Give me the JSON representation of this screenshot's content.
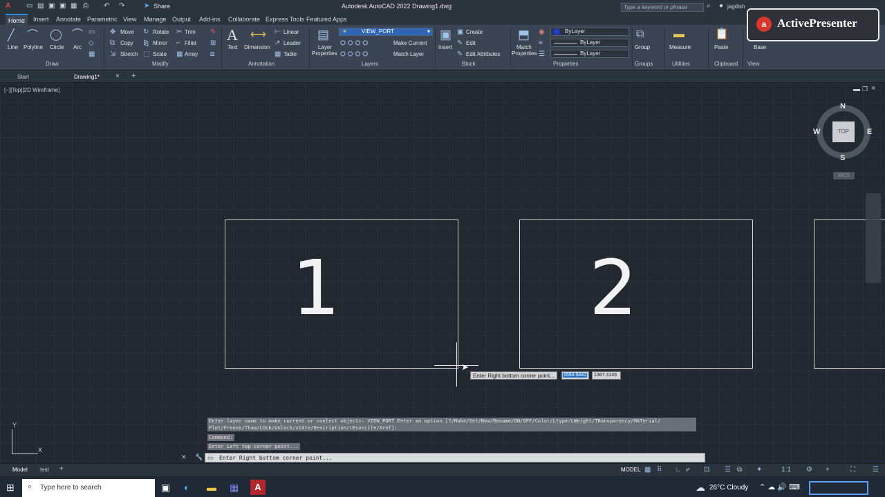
{
  "app": {
    "title": "Autodesk AutoCAD 2022    Drawing1.dwg",
    "share_label": "Share",
    "search_placeholder": "Type a keyword or phrase",
    "user": "jagdish"
  },
  "ribbon_tabs": [
    "Home",
    "Insert",
    "Annotate",
    "Parametric",
    "View",
    "Manage",
    "Output",
    "Add-ins",
    "Collaborate",
    "Express Tools",
    "Featured Apps"
  ],
  "draw": {
    "line": "Line",
    "polyline": "Polyline",
    "circle": "Circle",
    "arc": "Arc",
    "title": "Draw"
  },
  "modify": {
    "move": "Move",
    "rotate": "Rotate",
    "trim": "Trim",
    "copy": "Copy",
    "mirror": "Mirror",
    "fillet": "Fillet",
    "stretch": "Stretch",
    "scale": "Scale",
    "array": "Array",
    "title": "Modify"
  },
  "annotation": {
    "text": "Text",
    "dimension": "Dimension",
    "linear": "Linear",
    "leader": "Leader",
    "table": "Table",
    "title": "Annotation"
  },
  "layers": {
    "layer_properties_1": "Layer",
    "layer_properties_2": "Properties",
    "current_layer": "VIEW_PORT",
    "make_current": "Make Current",
    "match_layer": "Match Layer",
    "title": "Layers"
  },
  "block": {
    "insert": "Insert",
    "create": "Create",
    "edit": "Edit",
    "edit_attributes": "Edit Attributes",
    "title": "Block"
  },
  "properties": {
    "match_1": "Match",
    "match_2": "Properties",
    "color": "ByLayer",
    "linetype": "ByLayer",
    "lineweight": "ByLayer",
    "title": "Properties"
  },
  "groups": {
    "group": "Group",
    "title": "Groups"
  },
  "utilities": {
    "measure": "Measure",
    "title": "Utilities"
  },
  "clipboard": {
    "paste": "Paste",
    "title": "Clipboard"
  },
  "view_panel": {
    "base": "Base",
    "title": "View"
  },
  "doc_tabs": {
    "start": "Start",
    "drawing": "Drawing1*"
  },
  "viewport_label": "[−][Top][2D Wireframe]",
  "viewports": [
    {
      "label": "1"
    },
    {
      "label": "2"
    }
  ],
  "viewcube": {
    "north": "N",
    "south": "S",
    "east": "E",
    "west": "W",
    "top": "TOP",
    "wcs": "WCS"
  },
  "dynamic_input": {
    "prompt": "Enter Right bottom corner point...",
    "x": "1694.9442",
    "y": "1387.3146"
  },
  "command_history": [
    "Enter layer name to make current or <select object>: VIEW_PORT Enter an option [?/Make/Set/New/Rename/ON/OFF/Color/Ltype/LWeight/TRansparency/MATerial/",
    "Plot/Freeze/Thaw/LOck/Unlock/stAte/Description/rEconcile/Xref]:",
    "Command:",
    "Enter Left top corner point..."
  ],
  "command_line": "Enter Right bottom corner point...",
  "ucs": {
    "x": "X",
    "y": "Y"
  },
  "layout_tabs": {
    "model": "Model",
    "test": "test"
  },
  "status": {
    "model": "MODEL"
  },
  "taskbar": {
    "search_placeholder": "Type here to search",
    "weather": "26°C  Cloudy"
  },
  "watermark": "ActivePresenter"
}
